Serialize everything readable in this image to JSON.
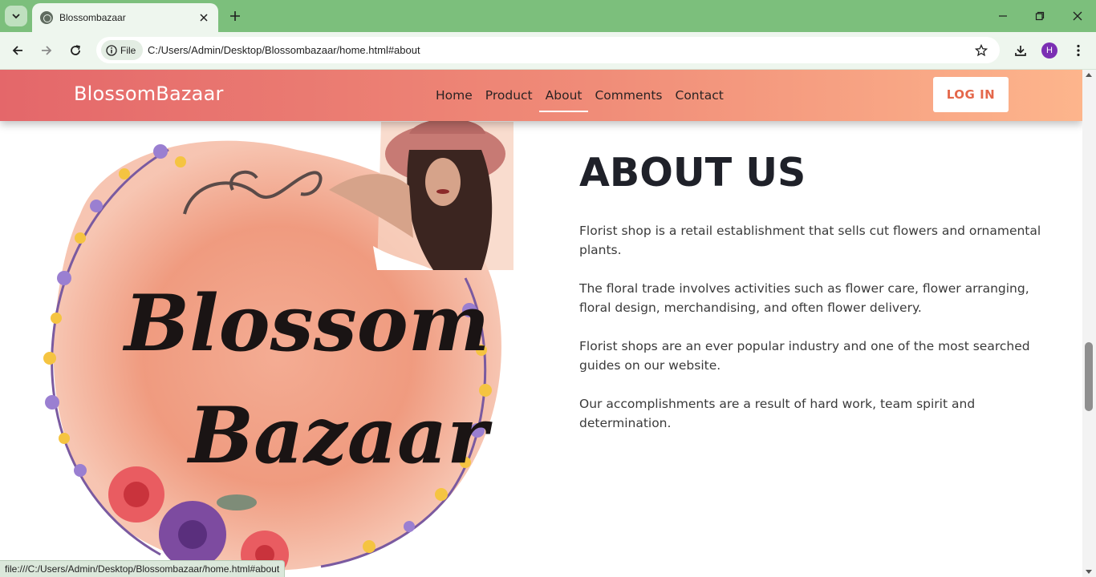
{
  "browser": {
    "tab_title": "Blossombazaar",
    "file_chip": "File",
    "url": "C:/Users/Admin/Desktop/Blossombazaar/home.html#about",
    "profile_initial": "H",
    "status_url": "file:///C:/Users/Admin/Desktop/Blossombazaar/home.html#about"
  },
  "site": {
    "brand": "BlossomBazaar",
    "nav": [
      "Home",
      "Product",
      "About",
      "Comments",
      "Contact"
    ],
    "active_nav": "About",
    "login_label": "LOG IN"
  },
  "logo": {
    "line1": "Blossom",
    "line2": "Bazaar"
  },
  "about": {
    "title": "ABOUT US",
    "paragraphs": [
      "Florist shop is a retail establishment that sells cut flowers and ornamental plants.",
      "The floral trade involves activities such as flower care, flower arranging, floral design, merchandising, and often flower delivery.",
      "Florist shops are an ever popular industry and one of the most searched guides on our website.",
      "Our accomplishments are a result of hard work, team spirit and determination."
    ]
  },
  "colors": {
    "header_start": "#e4676a",
    "header_end": "#fdb58c",
    "login_text": "#e4674a",
    "browser_frame": "#7cbf7c"
  }
}
